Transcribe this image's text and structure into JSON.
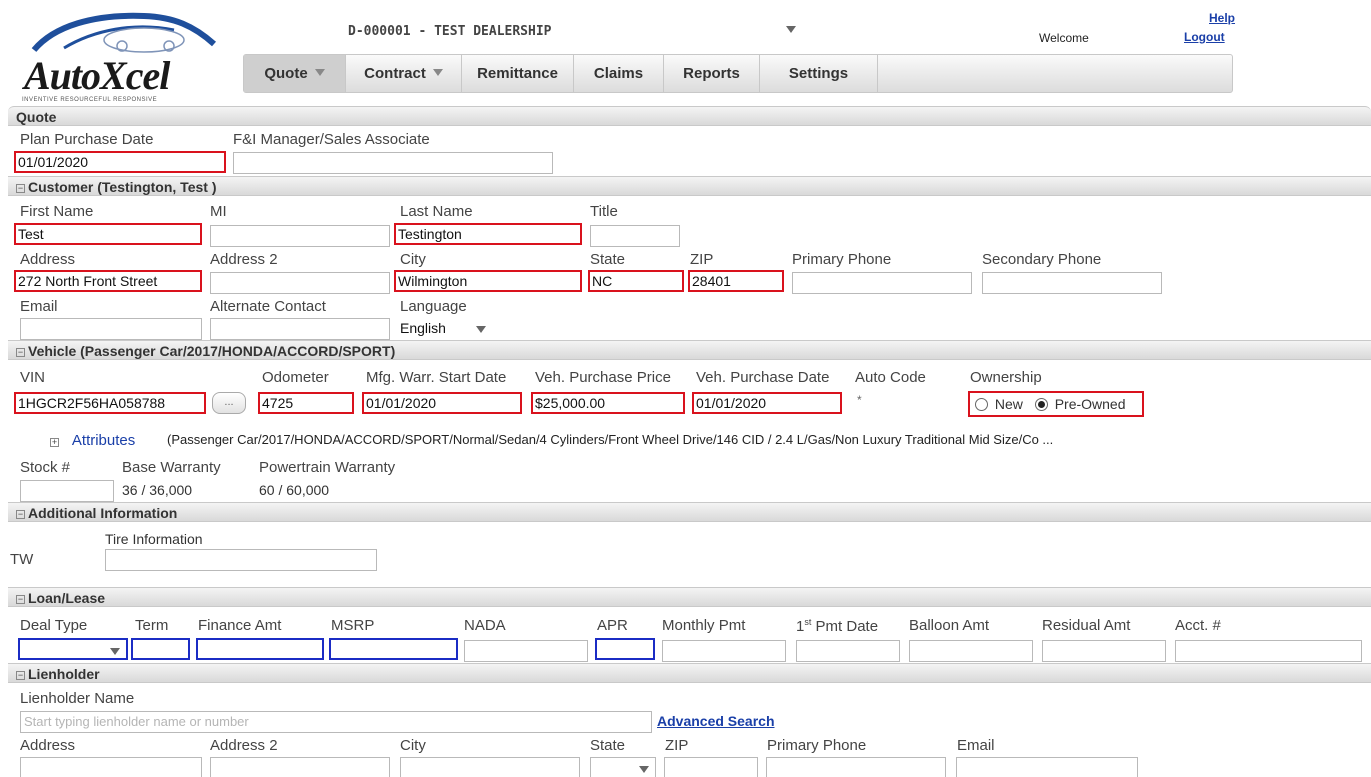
{
  "header": {
    "dealer": "D-000001 - TEST DEALERSHIP",
    "welcome": "Welcome",
    "help": "Help",
    "logout": "Logout",
    "logo_text": "AutoXcel",
    "logo_tagline": "INVENTIVE  RESOURCEFUL  RESPONSIVE"
  },
  "nav": {
    "tabs": [
      "Quote",
      "Contract",
      "Remittance",
      "Claims",
      "Reports",
      "Settings"
    ]
  },
  "quote": {
    "section": "Quote",
    "plan_date_label": "Plan Purchase Date",
    "plan_date": "01/01/2020",
    "manager_label": "F&I Manager/Sales Associate",
    "manager": ""
  },
  "customer": {
    "section": "Customer  (Testington, Test )",
    "labels": {
      "first": "First Name",
      "mi": "MI",
      "last": "Last Name",
      "title": "Title",
      "address": "Address",
      "address2": "Address 2",
      "city": "City",
      "state": "State",
      "zip": "ZIP",
      "phone": "Primary Phone",
      "phone2": "Secondary Phone",
      "email": "Email",
      "alt": "Alternate Contact",
      "language": "Language"
    },
    "first": "Test",
    "mi": "",
    "last": "Testington",
    "title": "",
    "address": "272 North Front Street",
    "address2": "",
    "city": "Wilmington",
    "state": "NC",
    "zip": "28401",
    "phone": "",
    "phone2": "",
    "email": "",
    "alt": "",
    "language": "English"
  },
  "vehicle": {
    "section": "Vehicle  (Passenger Car/2017/HONDA/ACCORD/SPORT)",
    "labels": {
      "vin": "VIN",
      "odometer": "Odometer",
      "mfg": "Mfg. Warr. Start Date",
      "price": "Veh. Purchase Price",
      "pdate": "Veh. Purchase Date",
      "auto_code": "Auto Code",
      "ownership": "Ownership",
      "stock": "Stock #",
      "base": "Base Warranty",
      "power": "Powertrain Warranty"
    },
    "vin": "1HGCR2F56HA058788",
    "vin_btn": "...",
    "odometer": "4725",
    "mfg": "01/01/2020",
    "price": "$25,000.00",
    "pdate": "01/01/2020",
    "auto_code": "*",
    "own_new": "New",
    "own_pre": "Pre-Owned",
    "attributes_link": "Attributes",
    "attributes": "(Passenger Car/2017/HONDA/ACCORD/SPORT/Normal/Sedan/4 Cylinders/Front Wheel Drive/146 CID / 2.4 L/Gas/Non Luxury Traditional Mid Size/Co ...",
    "stock": "",
    "base": "36 / 36,000",
    "power": "60 / 60,000"
  },
  "additional": {
    "section": "Additional Information",
    "tire_label": "Tire Information",
    "tw": "TW",
    "tire": ""
  },
  "loan": {
    "section": "Loan/Lease",
    "labels": {
      "deal": "Deal Type",
      "term": "Term",
      "finance": "Finance Amt",
      "msrp": "MSRP",
      "nada": "NADA",
      "apr": "APR",
      "monthly": "Monthly Pmt",
      "first_pmt_pre": "1",
      "first_pmt_sup": "st",
      "first_pmt_post": " Pmt Date",
      "balloon": "Balloon Amt",
      "residual": "Residual Amt",
      "acct": "Acct. #"
    }
  },
  "lienholder": {
    "section": "Lienholder",
    "name_label": "Lienholder Name",
    "name_placeholder": "Start typing lienholder name or number",
    "advanced": "Advanced Search",
    "labels": {
      "address": "Address",
      "address2": "Address 2",
      "city": "City",
      "state": "State",
      "zip": "ZIP",
      "phone": "Primary Phone",
      "email": "Email"
    }
  }
}
